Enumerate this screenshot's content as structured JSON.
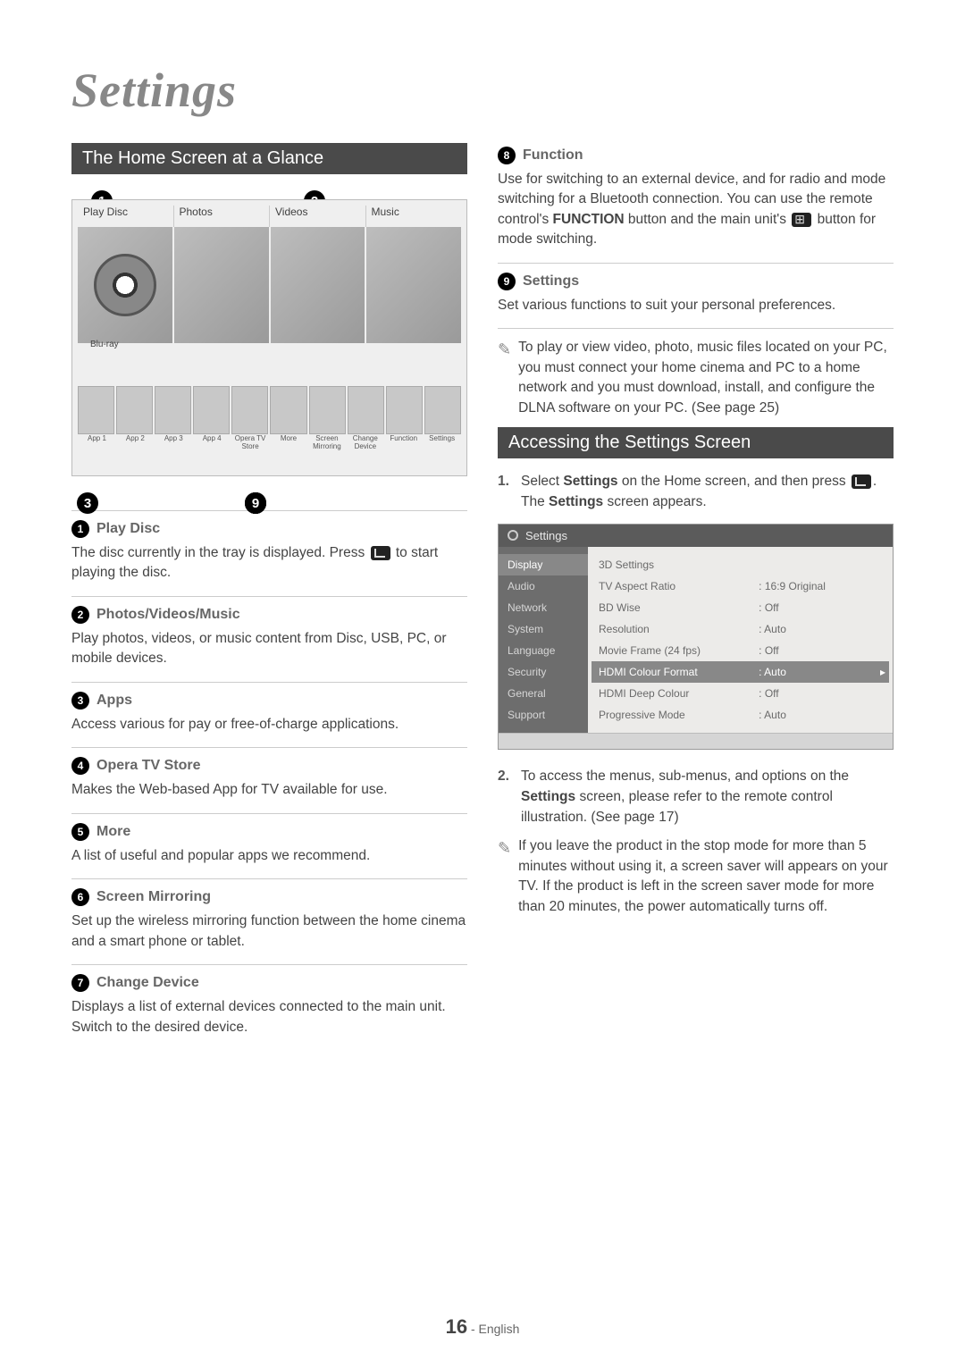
{
  "page_title": "Settings",
  "section_home": "The Home Screen at a Glance",
  "section_access": "Accessing the Settings Screen",
  "home_tiles": [
    "Play Disc",
    "Photos",
    "Videos",
    "Music"
  ],
  "bluray_label": "Blu-ray",
  "strip_labels": [
    "App 1",
    "App 2",
    "App 3",
    "App 4",
    "Opera TV Store",
    "More",
    "Screen Mirroring",
    "Change Device",
    "Function",
    "Settings"
  ],
  "items": {
    "1": {
      "title": "Play Disc",
      "body_a": "The disc currently in the tray is displayed. Press ",
      "body_b": " to start playing the disc."
    },
    "2": {
      "title": "Photos/Videos/Music",
      "body": "Play photos, videos, or music content from Disc, USB, PC, or mobile devices."
    },
    "3": {
      "title": "Apps",
      "body": "Access various for pay or free-of-charge applications."
    },
    "4": {
      "title": "Opera TV Store",
      "body": "Makes the Web-based App for TV available for use."
    },
    "5": {
      "title": "More",
      "body": "A list of useful and popular apps we recommend."
    },
    "6": {
      "title": "Screen Mirroring",
      "body": "Set up the wireless mirroring function between the home cinema and a smart phone or tablet."
    },
    "7": {
      "title": "Change Device",
      "body": "Displays a list of external devices connected to the main unit. Switch to the desired device."
    },
    "8": {
      "title": "Function",
      "body_a": "Use for switching to an external device, and for radio and mode switching for a Bluetooth connection. You can use the remote control's ",
      "body_b": "FUNCTION",
      "body_c": " button and the main unit's ",
      "body_d": " button for mode switching."
    },
    "9": {
      "title": "Settings",
      "body": "Set various functions to suit your personal preferences."
    }
  },
  "note_pc": "To play or view video, photo, music files located on your PC, you must connect your home cinema and PC to a home network and you must download, install, and configure the DLNA software on your PC. (See page 25)",
  "access_steps": {
    "1a": "Select ",
    "1b": "Settings",
    "1c": " on the Home screen, and then press ",
    "1d": ". The ",
    "1e": "Settings",
    "1f": " screen appears.",
    "2a": "To access the menus, sub-menus, and options on the ",
    "2b": "Settings",
    "2c": " screen, please refer to the remote control illustration. (See page 17)"
  },
  "note_idle": "If you leave the product in the stop mode for more than 5 minutes without using it, a screen saver will appears on your TV. If the product is left in the screen saver mode for more than 20 minutes, the power automatically turns off.",
  "settings_ui": {
    "title": "Settings",
    "sidebar": [
      "Display",
      "Audio",
      "Network",
      "System",
      "Language",
      "Security",
      "General",
      "Support"
    ],
    "rows": [
      {
        "label": "3D Settings",
        "value": ""
      },
      {
        "label": "TV Aspect Ratio",
        "value": ": 16:9 Original"
      },
      {
        "label": "BD Wise",
        "value": ": Off"
      },
      {
        "label": "Resolution",
        "value": ": Auto"
      },
      {
        "label": "Movie Frame (24 fps)",
        "value": ": Off"
      },
      {
        "label": "HDMI Colour Format",
        "value": ": Auto",
        "hl": true
      },
      {
        "label": "HDMI Deep Colour",
        "value": ": Off"
      },
      {
        "label": "Progressive Mode",
        "value": ": Auto"
      }
    ]
  },
  "footer": {
    "page": "16",
    "lang": " - English"
  }
}
